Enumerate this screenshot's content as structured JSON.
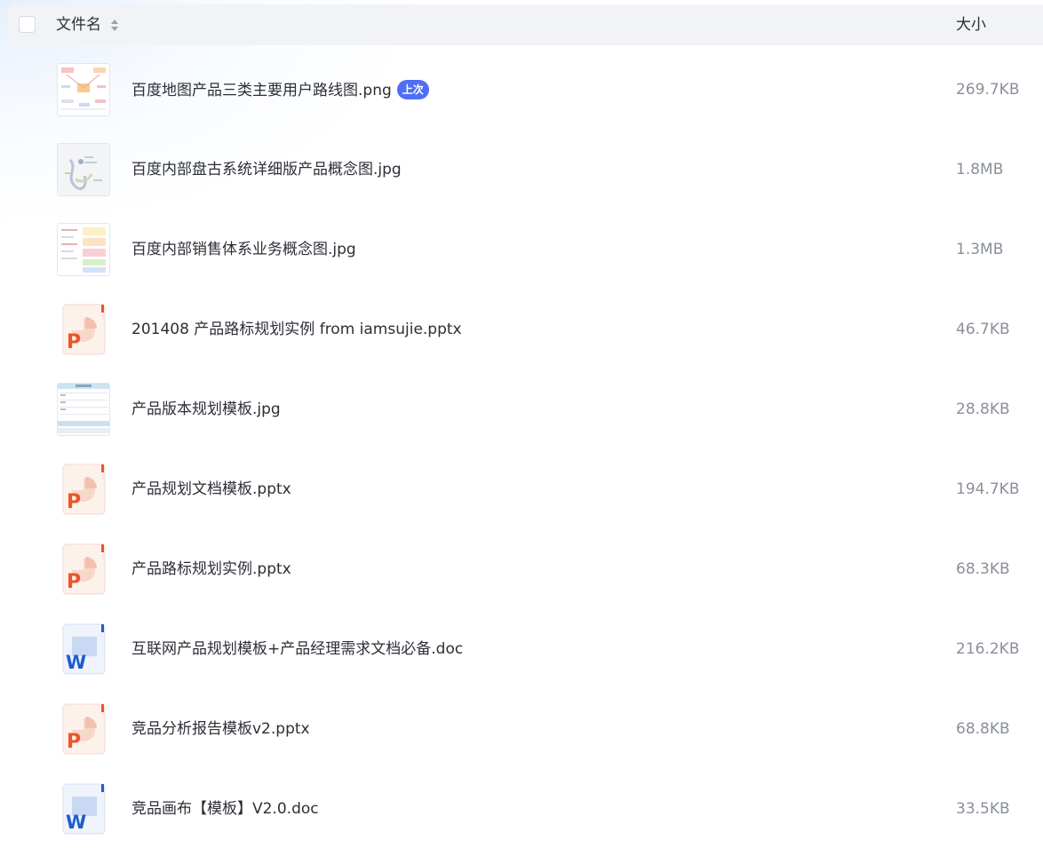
{
  "header": {
    "name_label": "文件名",
    "size_label": "大小"
  },
  "files": [
    {
      "name": "百度地图产品三类主要用户路线图.png",
      "size": "269.7KB",
      "icon": "image-thumbnail",
      "badge": "上次"
    },
    {
      "name": "百度内部盘古系统详细版产品概念图.jpg",
      "size": "1.8MB",
      "icon": "image-thumbnail"
    },
    {
      "name": "百度内部销售体系业务概念图.jpg",
      "size": "1.3MB",
      "icon": "image-thumbnail"
    },
    {
      "name": "201408 产品路标规划实例 from iamsujie.pptx",
      "size": "46.7KB",
      "icon": "ppt-icon"
    },
    {
      "name": "产品版本规划模板.jpg",
      "size": "28.8KB",
      "icon": "image-thumbnail"
    },
    {
      "name": "产品规划文档模板.pptx",
      "size": "194.7KB",
      "icon": "ppt-icon"
    },
    {
      "name": "产品路标规划实例.pptx",
      "size": "68.3KB",
      "icon": "ppt-icon"
    },
    {
      "name": "互联网产品规划模板+产品经理需求文档必备.doc",
      "size": "216.2KB",
      "icon": "word-icon"
    },
    {
      "name": "竞品分析报告模板v2.pptx",
      "size": "68.8KB",
      "icon": "ppt-icon"
    },
    {
      "name": "竞品画布【模板】V2.0.doc",
      "size": "33.5KB",
      "icon": "word-icon"
    }
  ],
  "colors": {
    "header_bg": "#f1f3f7",
    "badge_bg": "#4f6ef6",
    "ppt_accent": "#e8562a",
    "word_accent": "#1f5ccc"
  }
}
